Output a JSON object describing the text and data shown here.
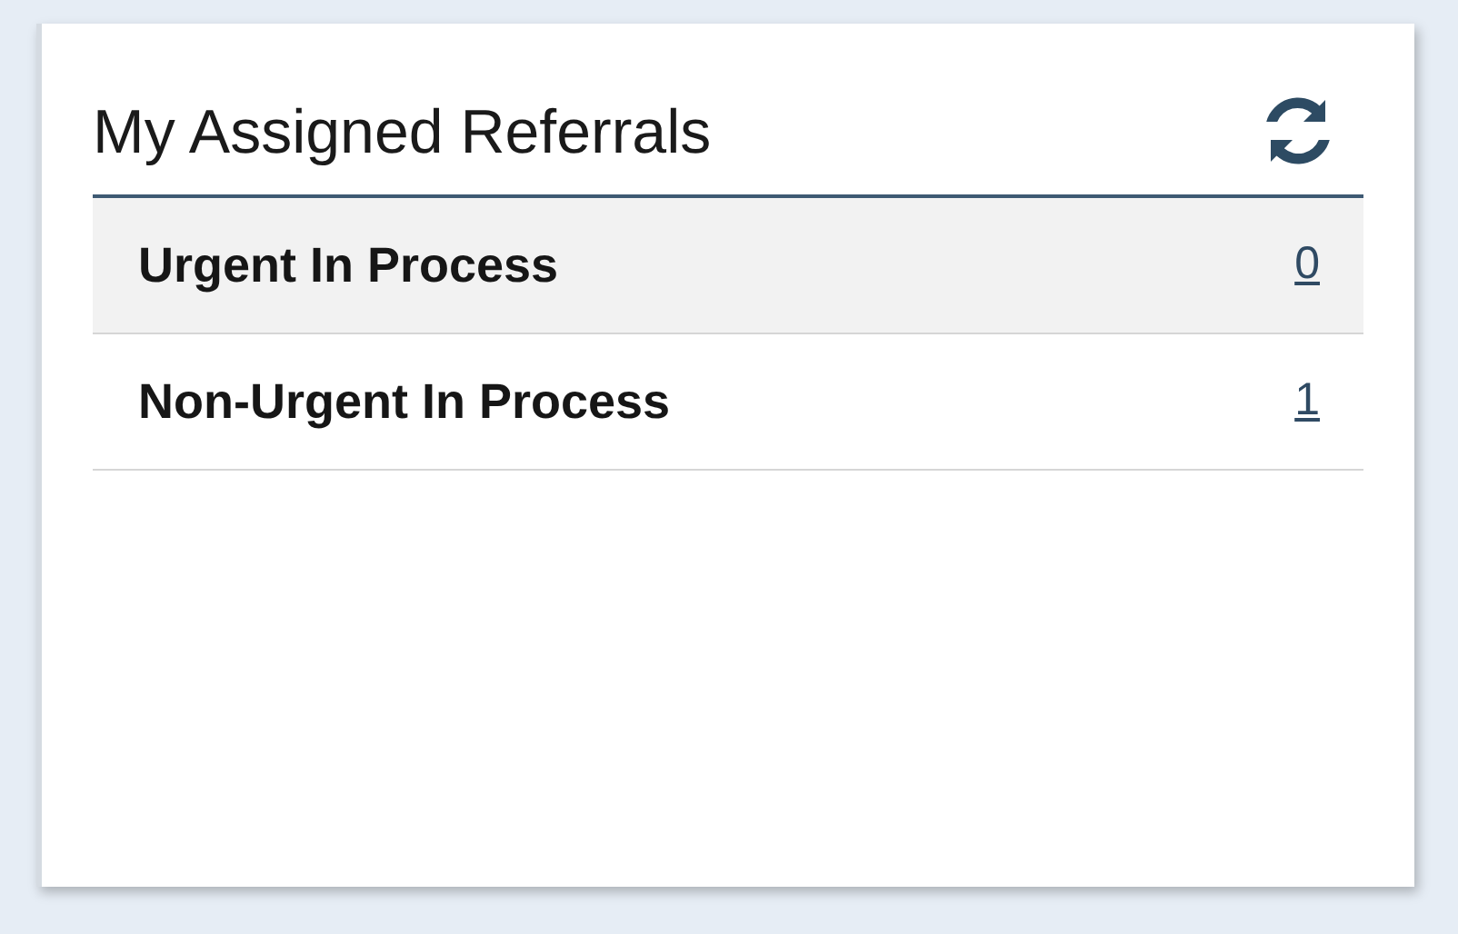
{
  "card": {
    "title": "My Assigned Referrals",
    "rows": [
      {
        "label": "Urgent In Process",
        "count": "0",
        "shaded": true
      },
      {
        "label": "Non-Urgent In Process",
        "count": "1",
        "shaded": false
      }
    ]
  }
}
